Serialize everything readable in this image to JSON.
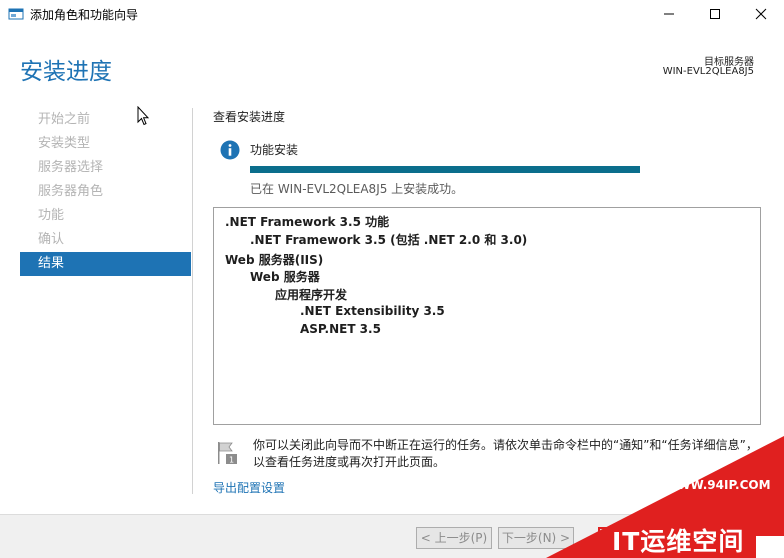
{
  "window": {
    "title": "添加角色和功能向导",
    "minimize_icon": "minimize-icon",
    "maximize_icon": "maximize-icon",
    "close_icon": "close-icon"
  },
  "header": {
    "page_title": "安装进度",
    "destination_label": "目标服务器",
    "destination_server": "WIN-EVL2QLEA8J5"
  },
  "nav": {
    "items": [
      {
        "label": "开始之前",
        "state": "disabled"
      },
      {
        "label": "安装类型",
        "state": "disabled"
      },
      {
        "label": "服务器选择",
        "state": "disabled"
      },
      {
        "label": "服务器角色",
        "state": "disabled"
      },
      {
        "label": "功能",
        "state": "disabled"
      },
      {
        "label": "确认",
        "state": "disabled"
      },
      {
        "label": "结果",
        "state": "active"
      }
    ]
  },
  "main": {
    "section_label": "查看安装进度",
    "status_icon": "info-icon",
    "status_text": "功能安装",
    "progress": 1.0,
    "success_message": "已在 WIN-EVL2QLEA8J5 上安装成功。",
    "features": [
      {
        "text": ".NET Framework 3.5 功能",
        "level": 0
      },
      {
        "text": ".NET Framework 3.5 (包括 .NET 2.0 和 3.0)",
        "level": 1
      },
      {
        "text": "Web 服务器(IIS)",
        "level": 0
      },
      {
        "text": "Web 服务器",
        "level": 1
      },
      {
        "text": "应用程序开发",
        "level": 2
      },
      {
        "text": ".NET Extensibility 3.5",
        "level": 3
      },
      {
        "text": "ASP.NET 3.5",
        "level": 3
      }
    ],
    "note_icon": "flag-icon",
    "note_text": "你可以关闭此向导而不中断正在运行的任务。请依次单击命令栏中的“通知”和“任务详细信息”，以查看任务进度或再次打开此页面。",
    "export_link": "导出配置设置"
  },
  "footer": {
    "prev_label": "< 上一步(P)",
    "next_label": "下一步(N) >",
    "close_label": ""
  },
  "watermark": {
    "url": "WWW.94IP.COM",
    "name": "IT运维空间"
  },
  "colors": {
    "accent": "#1e73b4",
    "progress": "#0b6e8c",
    "watermark": "#e0201f"
  }
}
